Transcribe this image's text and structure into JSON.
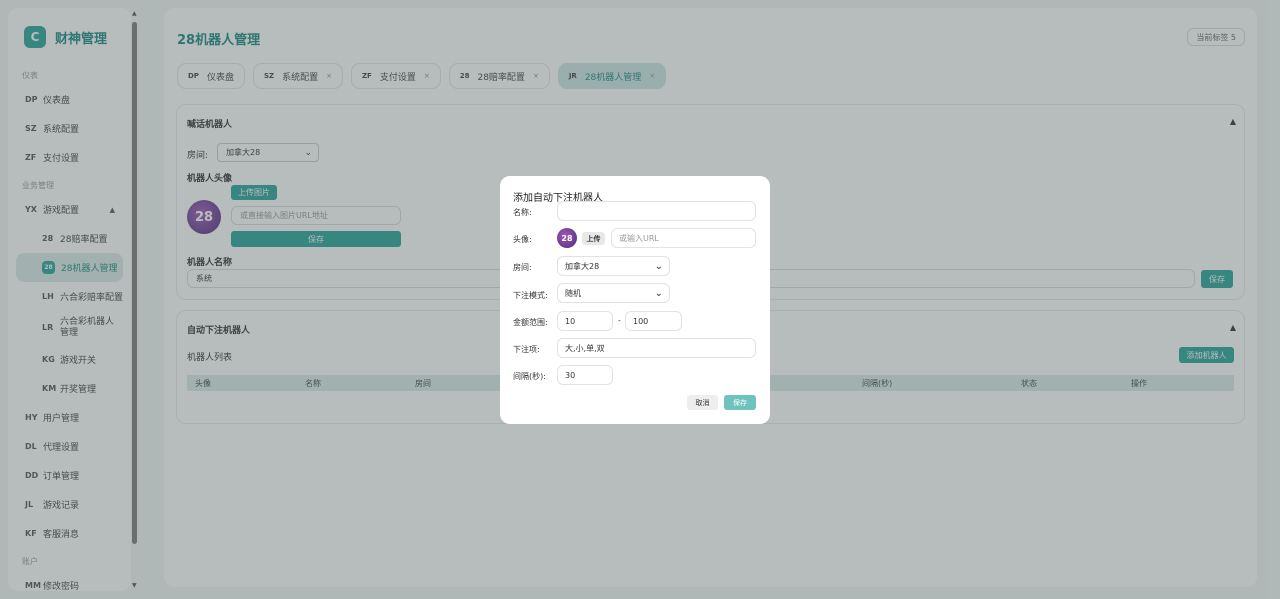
{
  "sidebar": {
    "brand_logo": "C",
    "brand_name": "财神管理",
    "sections": [
      "仪表",
      "业务管理",
      "账户"
    ],
    "items": [
      {
        "code": "DP",
        "label": "仪表盘"
      },
      {
        "code": "SZ",
        "label": "系统配置"
      },
      {
        "code": "ZF",
        "label": "支付设置"
      },
      {
        "code": "YX",
        "label": "游戏配置",
        "arrow": "▲"
      },
      {
        "code": "28",
        "label": "28赔率配置"
      },
      {
        "code": "28",
        "label": "28机器人管理"
      },
      {
        "code": "LH",
        "label": "六合彩赔率配置"
      },
      {
        "code": "LR",
        "label": "六合彩机器人管理"
      },
      {
        "code": "KG",
        "label": "游戏开关"
      },
      {
        "code": "KM",
        "label": "开奖管理"
      },
      {
        "code": "HY",
        "label": "用户管理"
      },
      {
        "code": "DL",
        "label": "代理设置"
      },
      {
        "code": "DD",
        "label": "订单管理"
      },
      {
        "code": "JL",
        "label": "游戏记录"
      },
      {
        "code": "KF",
        "label": "客服消息"
      },
      {
        "code": "MM",
        "label": "修改密码"
      }
    ]
  },
  "header": {
    "title": "28机器人管理",
    "current_tab": "当前标签 5"
  },
  "tabs": [
    {
      "code": "DP",
      "label": "仪表盘",
      "close": ""
    },
    {
      "code": "SZ",
      "label": "系统配置",
      "close": "×"
    },
    {
      "code": "ZF",
      "label": "支付设置",
      "close": "×"
    },
    {
      "code": "28",
      "label": "28赔率配置",
      "close": "×"
    },
    {
      "code": "JR",
      "label": "28机器人管理",
      "close": "×"
    }
  ],
  "shout_robot": {
    "title": "喊话机器人",
    "toggle": "▲",
    "room_label": "房间:",
    "room_value": "加拿大28",
    "avatar_label": "机器人头像",
    "upload_btn": "上传图片",
    "url_placeholder": "或直接输入图片URL地址",
    "save_btn": "保存",
    "name_label": "机器人名称",
    "name_value": "系统",
    "name_save_btn": "保存",
    "avatar_text": "28"
  },
  "auto_robot": {
    "title": "自动下注机器人",
    "toggle": "▲",
    "list_label": "机器人列表",
    "add_btn": "添加机器人",
    "columns": [
      "头像",
      "名称",
      "房间",
      "间隔(秒)",
      "状态",
      "操作"
    ]
  },
  "dialog": {
    "title": "添加自动下注机器人",
    "name_label": "名称:",
    "name_value": "",
    "avatar_label": "头像:",
    "avatar_text": "28",
    "upload_btn": "上传",
    "url_placeholder": "或输入URL",
    "room_label": "房间:",
    "room_value": "加拿大28",
    "mode_label": "下注模式:",
    "mode_value": "随机",
    "amount_label": "金额范围:",
    "amount_min": "10",
    "amount_max": "100",
    "amount_sep": "-",
    "bet_label": "下注项:",
    "bet_value": "大,小,单,双",
    "interval_label": "间隔(秒):",
    "interval_value": "30",
    "cancel_btn": "取消",
    "save_btn": "保存"
  },
  "colors": {
    "accent": "#2aa39a",
    "accent_light": "#dcecea",
    "save_disabled": "#6fc3bd"
  }
}
